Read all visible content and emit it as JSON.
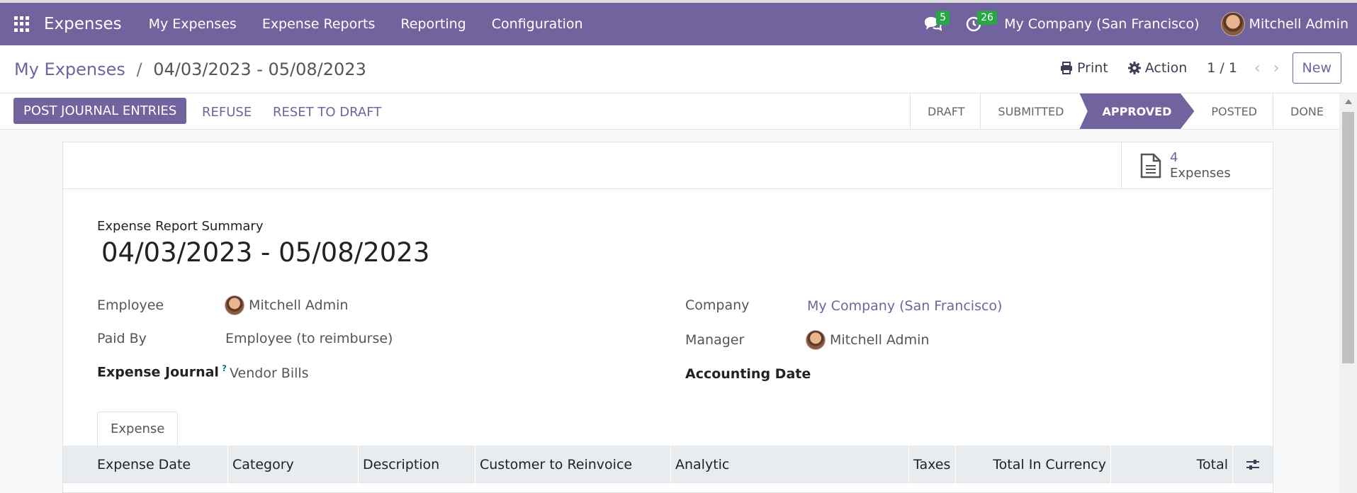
{
  "nav": {
    "brand": "Expenses",
    "menu": [
      "My Expenses",
      "Expense Reports",
      "Reporting",
      "Configuration"
    ],
    "messages_count": "5",
    "activities_count": "26",
    "company": "My Company (San Francisco)",
    "user": "Mitchell Admin"
  },
  "control": {
    "breadcrumb_parent": "My Expenses",
    "breadcrumb_separator": "/",
    "breadcrumb_current": "04/03/2023 - 05/08/2023",
    "print_label": "Print",
    "action_label": "Action",
    "pager": "1 / 1",
    "new_label": "New"
  },
  "statusbar": {
    "post_label": "POST JOURNAL ENTRIES",
    "refuse_label": "REFUSE",
    "reset_label": "RESET TO DRAFT",
    "stages": [
      "DRAFT",
      "SUBMITTED",
      "APPROVED",
      "POSTED",
      "DONE"
    ],
    "active_stage": "APPROVED"
  },
  "sheet": {
    "stat_value": "4",
    "stat_label": "Expenses",
    "summary_label": "Expense Report Summary",
    "title": "04/03/2023 - 05/08/2023",
    "fields": {
      "employee_label": "Employee",
      "employee_value": "Mitchell Admin",
      "paid_by_label": "Paid By",
      "paid_by_value": "Employee (to reimburse)",
      "journal_label": "Expense Journal",
      "journal_help": "?",
      "journal_value": "Vendor Bills",
      "company_label": "Company",
      "company_value": "My Company (San Francisco)",
      "manager_label": "Manager",
      "manager_value": "Mitchell Admin",
      "accounting_date_label": "Accounting Date"
    },
    "tab_label": "Expense",
    "columns": [
      "Expense Date",
      "Category",
      "Description",
      "Customer to Reinvoice",
      "Analytic",
      "Taxes",
      "Total In Currency",
      "Total"
    ]
  },
  "colors": {
    "brand": "#71639e",
    "badge": "#28a745"
  }
}
